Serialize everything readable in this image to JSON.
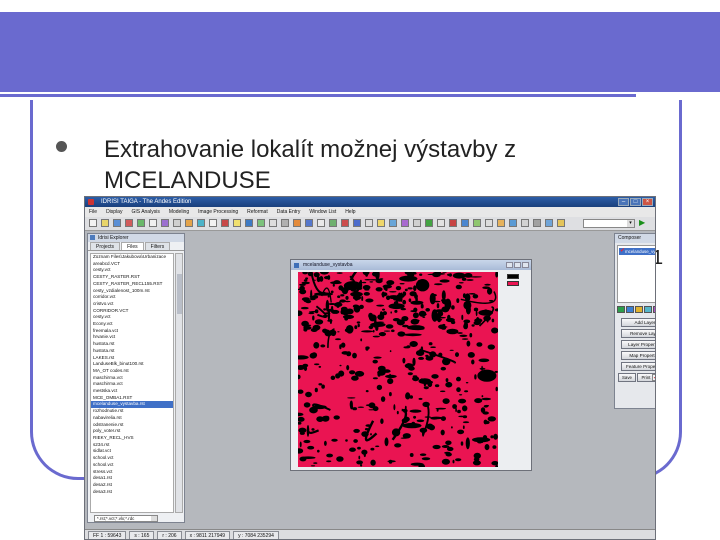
{
  "slide": {
    "bullet_text": "Extrahovanie lokalít možnej výstavby z MCELANDUSE",
    "trailing_text": "1"
  },
  "app": {
    "title": "IDRISI TAIGA - The Andes Edition",
    "menu": [
      "File",
      "Display",
      "GIS Analysis",
      "Modeling",
      "Image Processing",
      "Reformat",
      "Data Entry",
      "Window List",
      "Help"
    ],
    "explorer": {
      "title": "Idrisi Explorer",
      "tabs": [
        "Projects",
        "Files",
        "Filters"
      ],
      "files": [
        "Zoznam Files\\Jakubova\\Urbanizace",
        "areabcd.VCT",
        "cesty.vct",
        "CESTY_RASTER.RST",
        "CESTY_RASTER_RECL155.RST",
        "cesty_vzdialenost_100m.rst",
        "corridor.vct",
        "cristvo.vct",
        "CORRIDOR.VCT",
        "cesty.vct",
        "Econy.vct",
        "freemala.vct",
        "hrvanie.vct",
        "hustota.rst",
        "hustota.rst",
        "LAKES.rst",
        "LanduseBlk_binut100.rst",
        "MA_OT codes.rst",
        "maschirma.vct",
        "maschirma.vct",
        "mestska.vct",
        "MCE_OMBA1.RST",
        "mcelanduse_vystavba.rst",
        "rozhodnutie.rst",
        "nabavirelia.rst",
        "odstranenie.rst",
        "poly_voter.rst",
        "RIEKY_RECL_HVS",
        "s234.rst",
        "sidlat.vct",
        "school.vct",
        "school.vct",
        "stress.vct",
        "desa1.rst",
        "desa2.rst",
        "desa3.rst"
      ],
      "selected_index": 22,
      "filter_value": "*.rst;*.vct;*.vlx;*.rdc"
    },
    "map_window": {
      "title": "mcelanduse_vystavba",
      "legend_colors": [
        "#000000",
        "#ea1452"
      ]
    },
    "composer": {
      "title": "Composer",
      "layer_name": "mcelanduse_vystavba",
      "buttons": [
        "Add Layer",
        "Remove Layer",
        "Layer Properties",
        "Map Properties",
        "Feature Properties"
      ],
      "small_buttons": [
        "Save",
        "Print"
      ]
    },
    "status": {
      "file": "FF 1 : 59643",
      "scale": "s : 165",
      "row": "r : 206",
      "x": "x : 9811 217949",
      "y": "y : 7084 235294"
    }
  },
  "colors": {
    "frame": "#6a6acf",
    "map_fill": "#ea1452",
    "map_ink": "#000000",
    "selection": "#3f70c7"
  }
}
